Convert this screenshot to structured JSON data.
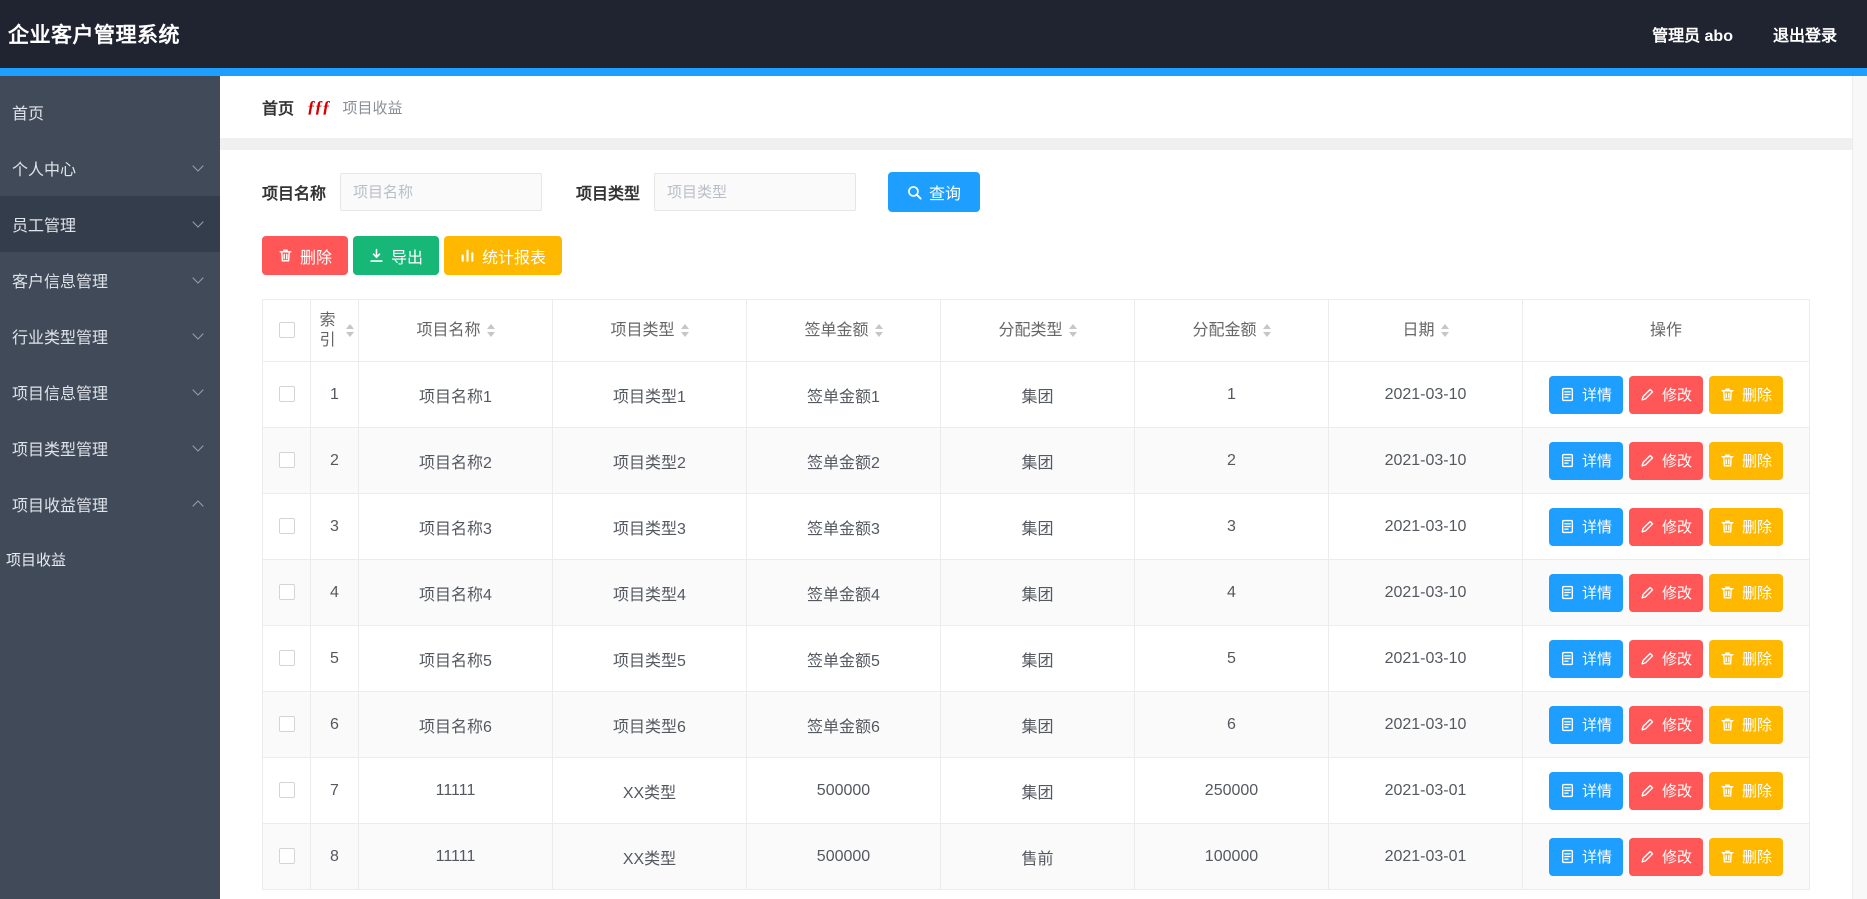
{
  "topbar": {
    "title": "企业客户管理系统",
    "user": "管理员 abo",
    "logout": "退出登录"
  },
  "colors": {
    "accent_blue": "#1e9fff",
    "danger_red": "#ff5757",
    "success_green": "#16b777",
    "warning_yellow": "#ffb800",
    "topbar_bg": "#1f2430",
    "sidebar_bg": "#404a59",
    "breadcrumb_separator_red": "#d20000"
  },
  "sidebar": {
    "items": [
      {
        "key": "home",
        "label": "首页",
        "chevron": "none",
        "highlight": false
      },
      {
        "key": "profile",
        "label": "个人中心",
        "chevron": "down",
        "highlight": false
      },
      {
        "key": "staff-management",
        "label": "员工管理",
        "chevron": "down",
        "highlight": true
      },
      {
        "key": "customer-info-management",
        "label": "客户信息管理",
        "chevron": "down",
        "highlight": false
      },
      {
        "key": "industry-type-management",
        "label": "行业类型管理",
        "chevron": "down",
        "highlight": false
      },
      {
        "key": "project-info-management",
        "label": "项目信息管理",
        "chevron": "down",
        "highlight": false
      },
      {
        "key": "project-type-management",
        "label": "项目类型管理",
        "chevron": "down",
        "highlight": false
      },
      {
        "key": "project-income-management",
        "label": "项目收益管理",
        "chevron": "up",
        "highlight": false
      }
    ],
    "subitems": [
      {
        "key": "project-income",
        "label": "项目收益"
      }
    ]
  },
  "breadcrumb": {
    "home": "首页",
    "separator": "ƒƒƒ",
    "current": "项目收益"
  },
  "search": {
    "name_label": "项目名称",
    "name_placeholder": "项目名称",
    "name_value": "",
    "type_label": "项目类型",
    "type_placeholder": "项目类型",
    "type_value": "",
    "query_label": "查询"
  },
  "toolbar": {
    "buttons": [
      {
        "name": "delete-button",
        "label": "删除",
        "icon": "trash-icon",
        "class": "red"
      },
      {
        "name": "export-button",
        "label": "导出",
        "icon": "download-icon",
        "class": "green"
      },
      {
        "name": "report-button",
        "label": "统计报表",
        "icon": "bar-chart-icon",
        "class": "yellow"
      }
    ]
  },
  "table": {
    "select_all": false,
    "col_keys": [
      "index",
      "project-name",
      "project-type",
      "sign-amount",
      "alloc-type",
      "alloc-amount",
      "date"
    ],
    "headers": [
      {
        "label": "索引",
        "sortable": true
      },
      {
        "label": "项目名称",
        "sortable": true
      },
      {
        "label": "项目类型",
        "sortable": true
      },
      {
        "label": "签单金额",
        "sortable": true
      },
      {
        "label": "分配类型",
        "sortable": true
      },
      {
        "label": "分配金额",
        "sortable": true
      },
      {
        "label": "日期",
        "sortable": true
      },
      {
        "label": "操作",
        "sortable": false
      }
    ],
    "rows": [
      {
        "checked": false,
        "cells": [
          "1",
          "项目名称1",
          "项目类型1",
          "签单金额1",
          "集团",
          "1",
          "2021-03-10"
        ]
      },
      {
        "checked": false,
        "cells": [
          "2",
          "项目名称2",
          "项目类型2",
          "签单金额2",
          "集团",
          "2",
          "2021-03-10"
        ]
      },
      {
        "checked": false,
        "cells": [
          "3",
          "项目名称3",
          "项目类型3",
          "签单金额3",
          "集团",
          "3",
          "2021-03-10"
        ]
      },
      {
        "checked": false,
        "cells": [
          "4",
          "项目名称4",
          "项目类型4",
          "签单金额4",
          "集团",
          "4",
          "2021-03-10"
        ]
      },
      {
        "checked": false,
        "cells": [
          "5",
          "项目名称5",
          "项目类型5",
          "签单金额5",
          "集团",
          "5",
          "2021-03-10"
        ]
      },
      {
        "checked": false,
        "cells": [
          "6",
          "项目名称6",
          "项目类型6",
          "签单金额6",
          "集团",
          "6",
          "2021-03-10"
        ]
      },
      {
        "checked": false,
        "cells": [
          "7",
          "11111",
          "XX类型",
          "500000",
          "集团",
          "250000",
          "2021-03-01"
        ]
      },
      {
        "checked": false,
        "cells": [
          "8",
          "11111",
          "XX类型",
          "500000",
          "售前",
          "100000",
          "2021-03-01"
        ]
      }
    ],
    "row_actions": [
      {
        "name": "detail-button",
        "label": "详情",
        "icon": "document-icon",
        "class": "blue"
      },
      {
        "name": "edit-button",
        "label": "修改",
        "icon": "edit-icon",
        "class": "red"
      },
      {
        "name": "delete-button",
        "label": "删除",
        "icon": "trash-icon",
        "class": "yellow"
      }
    ]
  }
}
